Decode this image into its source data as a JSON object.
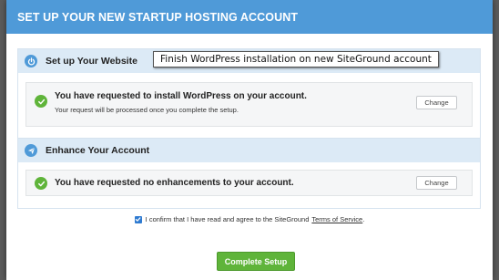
{
  "modal": {
    "title": "SET UP YOUR NEW STARTUP HOSTING ACCOUNT"
  },
  "tooltip": {
    "text": "Finish WordPress installation on new SiteGround account"
  },
  "website_section": {
    "title": "Set up Your Website",
    "icon": "power-icon",
    "card_title": "You have requested to install WordPress on your account.",
    "card_subtitle": "Your request will be processed once you complete the setup.",
    "change_label": "Change"
  },
  "enhance_section": {
    "title": "Enhance Your Account",
    "icon": "paper-plane-icon",
    "card_title": "You have requested no enhancements to your account.",
    "change_label": "Change"
  },
  "confirm": {
    "checked": true,
    "text": "I confirm that I have read and agree to the SiteGround",
    "link_text": "Terms of Service",
    "suffix": "."
  },
  "footer": {
    "complete_label": "Complete Setup"
  },
  "colors": {
    "header": "#4f9ad8",
    "section_head": "#dceaf6",
    "success": "#5fb43a",
    "checkbox": "#2f7bd1"
  }
}
